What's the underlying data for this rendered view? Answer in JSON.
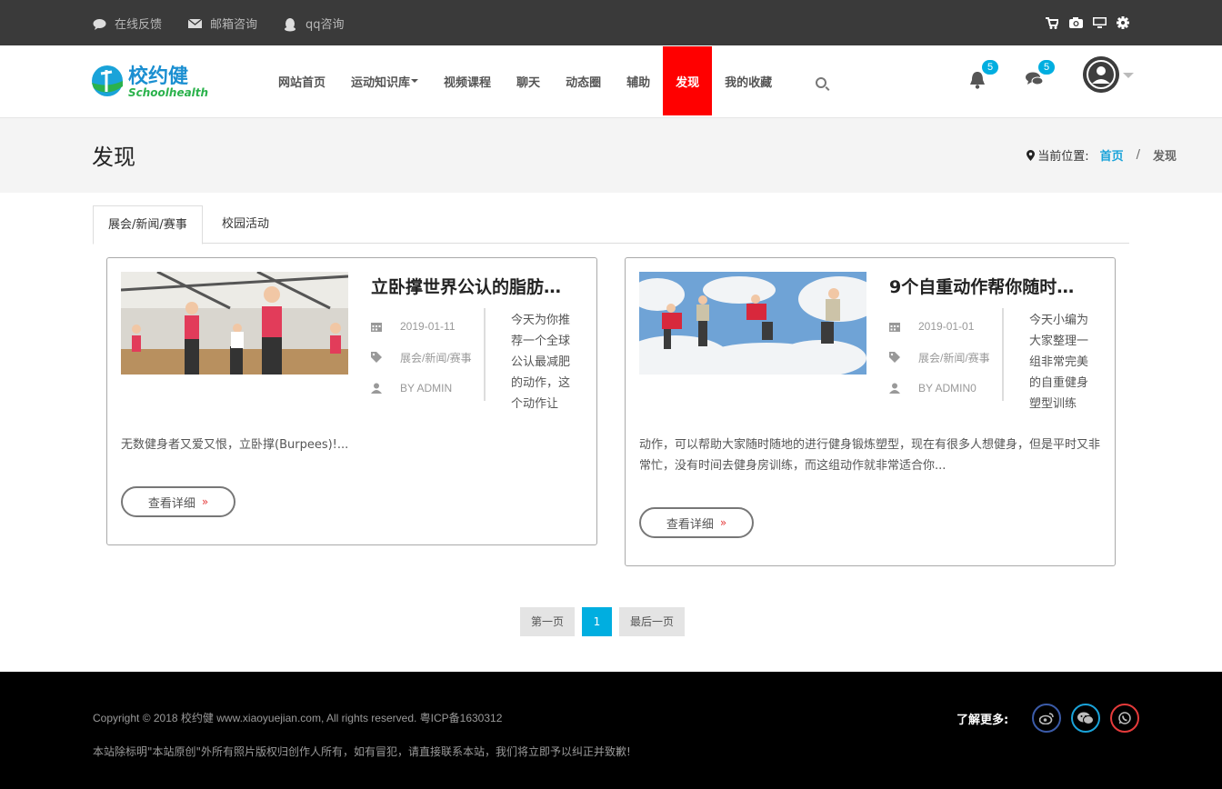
{
  "topbar": {
    "feedback": "在线反馈",
    "email": "邮箱咨询",
    "qq": "qq咨询",
    "right_icons": [
      "cart-icon",
      "camera-icon",
      "monitor-icon",
      "gear-icon"
    ]
  },
  "header": {
    "logo_text": "校约健",
    "logo_sub": "Schoolhealth",
    "nav": [
      "网站首页",
      "运动知识库",
      "视频课程",
      "聊天",
      "动态圈",
      "辅助",
      "发现",
      "我的收藏"
    ],
    "active_nav": "发现",
    "notif_count": "5",
    "msg_count": "5"
  },
  "page": {
    "title": "发现",
    "crumb_label": "当前位置:",
    "crumb_home": "首页",
    "crumb_sep": "/",
    "crumb_current": "发现"
  },
  "tabs": [
    "展会/新闻/赛事",
    "校园活动"
  ],
  "posts": [
    {
      "title": "立卧撑世界公认的脂肪…",
      "date": "2019-01-11",
      "category": "展会/新闻/赛事",
      "author": "BY ADMIN",
      "excerpt_side": "今天为你推荐一个全球公认最减肥的动作，这个动作让",
      "excerpt_rest": "无数健身者又爱又恨，立卧撑(Burpees)!...",
      "more": "查看详细"
    },
    {
      "title": "9个自重动作帮你随时…",
      "date": "2019-01-01",
      "category": "展会/新闻/赛事",
      "author": "BY ADMIN0",
      "excerpt_side": "今天小编为大家整理一组非常完美的自重健身塑型训练",
      "excerpt_rest": "动作，可以帮助大家随时随地的进行健身锻炼塑型，现在有很多人想健身，但是平时又非常忙，没有时间去健身房训练，而这组动作就非常适合你...",
      "more": "查看详细"
    }
  ],
  "pager": {
    "first": "第一页",
    "current": "1",
    "last": "最后一页"
  },
  "footer": {
    "copyright": "Copyright © 2018 校约健 www.xiaoyuejian.com, All rights reserved. 粤ICP备1630312",
    "note": "本站除标明\"本站原创\"外所有照片版权归创作人所有，如有冒犯，请直接联系本站，我们将立即予以纠正并致歉!",
    "more_label": "了解更多:",
    "social": [
      "weibo-icon",
      "wechat-icon",
      "whatsapp-icon"
    ]
  },
  "colors": {
    "accent": "#00aee0",
    "active_nav": "#ff0000",
    "topbar": "#3a3a3a",
    "footer": "#000000"
  }
}
